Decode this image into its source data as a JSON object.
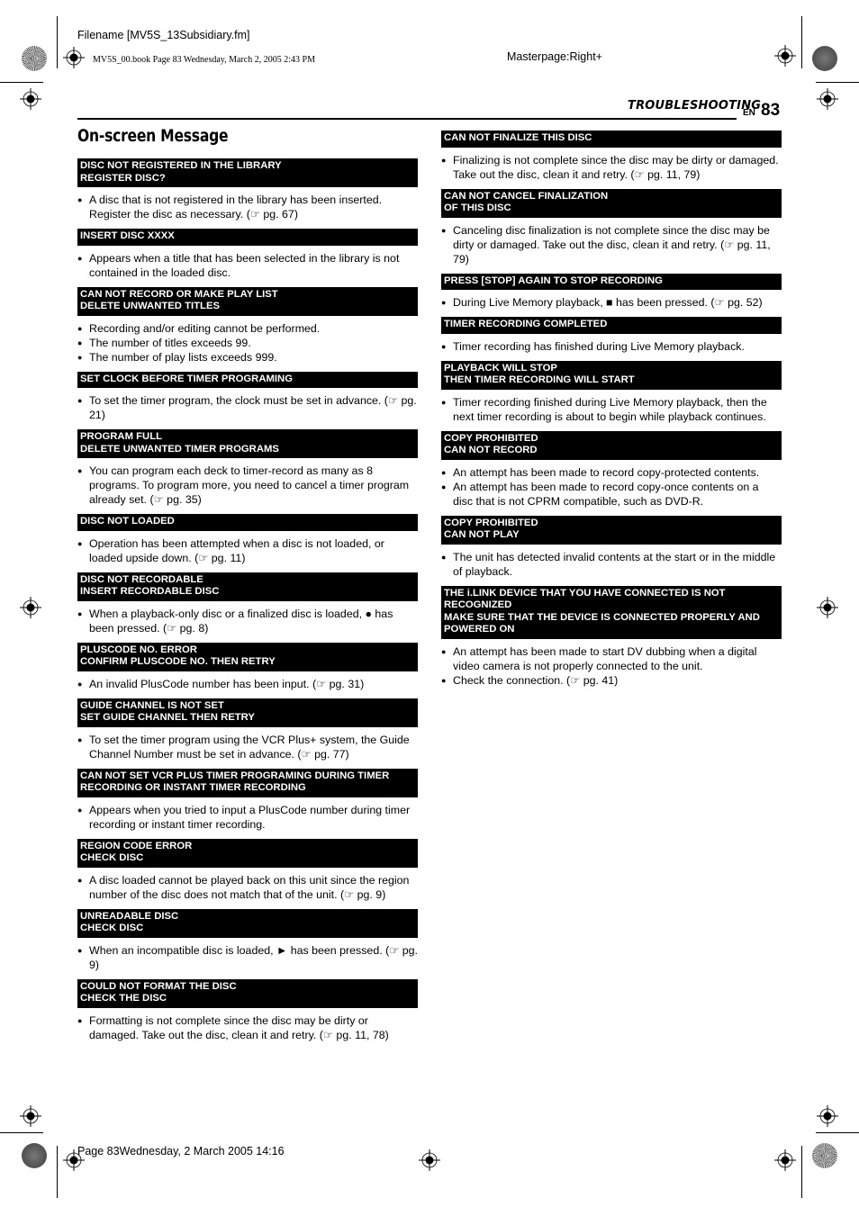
{
  "print_meta": {
    "filename": "Filename [MV5S_13Subsidiary.fm]",
    "book_line": "MV5S_00.book  Page 83  Wednesday, March 2, 2005  2:43 PM",
    "masterpage": "Masterpage:Right+",
    "footer": "Page 83Wednesday, 2 March 2005  14:16"
  },
  "header": {
    "section": "TROUBLESHOOTING",
    "lang": "EN",
    "page_number": "83"
  },
  "page_title": "On-screen Message",
  "left_column": [
    {
      "title": "DISC NOT REGISTERED IN THE LIBRARY\nREGISTER DISC?",
      "bullets": [
        "A disc that is not registered in the library has been inserted. Register the disc as necessary. (☞ pg. 67)"
      ]
    },
    {
      "title": "INSERT DISC XXXX",
      "bullets": [
        "Appears when a title that has been selected in the library is not contained in the loaded disc."
      ]
    },
    {
      "title": "CAN NOT RECORD OR MAKE PLAY LIST\nDELETE UNWANTED TITLES",
      "bullets": [
        "Recording and/or editing cannot be performed.",
        "The number of titles exceeds 99.",
        "The number of play lists exceeds 999."
      ]
    },
    {
      "title": "SET CLOCK BEFORE TIMER PROGRAMING",
      "bullets": [
        "To set the timer program, the clock must be set in advance. (☞ pg. 21)"
      ]
    },
    {
      "title": "PROGRAM FULL\nDELETE UNWANTED TIMER PROGRAMS",
      "bullets": [
        "You can program each deck to timer-record as many as 8 programs. To program more, you need to cancel a timer program already set. (☞ pg. 35)"
      ]
    },
    {
      "title": "DISC NOT LOADED",
      "bullets": [
        "Operation has been attempted when a disc is not loaded, or loaded upside down. (☞ pg. 11)"
      ]
    },
    {
      "title": "DISC NOT RECORDABLE\nINSERT RECORDABLE DISC",
      "bullets": [
        "When a playback-only disc or a finalized disc is loaded, ● has been pressed. (☞ pg. 8)"
      ]
    },
    {
      "title": "PLUSCODE NO. ERROR\nCONFIRM PLUSCODE NO. THEN RETRY",
      "bullets": [
        "An invalid PlusCode number has been input. (☞ pg. 31)"
      ]
    },
    {
      "title": "GUIDE CHANNEL IS NOT SET\nSET GUIDE CHANNEL THEN RETRY",
      "bullets": [
        "To set the timer program using the VCR Plus+ system, the Guide Channel Number must be set in advance. (☞ pg. 77)"
      ]
    },
    {
      "title": "CAN NOT SET VCR PLUS TIMER PROGRAMING DURING TIMER RECORDING OR INSTANT TIMER RECORDING",
      "bullets": [
        "Appears when you tried to input a PlusCode number during timer recording or instant timer recording."
      ]
    },
    {
      "title": "REGION CODE ERROR\nCHECK DISC",
      "bullets": [
        "A disc loaded cannot be played back on this unit since the region number of the disc does not match that of the unit. (☞ pg. 9)"
      ]
    },
    {
      "title": "UNREADABLE DISC\nCHECK DISC",
      "bullets": [
        "When an incompatible disc is loaded, ► has been pressed. (☞ pg. 9)"
      ]
    },
    {
      "title": "COULD NOT FORMAT THE DISC\nCHECK THE DISC",
      "bullets": [
        "Formatting is not complete since the disc may be dirty or damaged. Take out the disc, clean it and retry. (☞ pg. 11, 78)"
      ]
    }
  ],
  "right_column": [
    {
      "title": "CAN NOT FINALIZE THIS DISC",
      "bullets": [
        "Finalizing is not complete since the disc may be dirty or damaged. Take out the disc, clean it and retry. (☞ pg. 11, 79)"
      ]
    },
    {
      "title": "CAN NOT CANCEL FINALIZATION\nOF THIS DISC",
      "bullets": [
        "Canceling disc finalization is not complete since the disc may be dirty or damaged. Take out the disc, clean it and retry. (☞ pg. 11, 79)"
      ]
    },
    {
      "title": "PRESS [STOP] AGAIN TO STOP RECORDING",
      "bullets": [
        "During Live Memory playback, ■ has been pressed. (☞ pg. 52)"
      ]
    },
    {
      "title": "TIMER RECORDING COMPLETED",
      "bullets": [
        "Timer recording has finished during Live Memory playback."
      ]
    },
    {
      "title": "PLAYBACK WILL STOP\nTHEN TIMER RECORDING WILL START",
      "bullets": [
        "Timer recording finished during Live Memory playback, then the next timer recording is about to begin while playback continues."
      ]
    },
    {
      "title": "COPY PROHIBITED\nCAN NOT RECORD",
      "bullets": [
        "An attempt has been made to record copy-protected contents.",
        "An attempt has been made to record copy-once contents on a disc that is not CPRM compatible, such as DVD-R."
      ]
    },
    {
      "title": "COPY PROHIBITED\nCAN NOT PLAY",
      "bullets": [
        "The unit has detected invalid contents at the start or in the middle of playback."
      ]
    },
    {
      "title": "THE i.LINK DEVICE THAT YOU HAVE CONNECTED IS NOT RECOGNIZED\nMAKE SURE THAT THE DEVICE IS CONNECTED PROPERLY AND POWERED ON",
      "bullets": [
        "An attempt has been made to start DV dubbing when a digital video camera is not properly connected to the unit.",
        "Check the connection. (☞ pg. 41)"
      ]
    }
  ]
}
